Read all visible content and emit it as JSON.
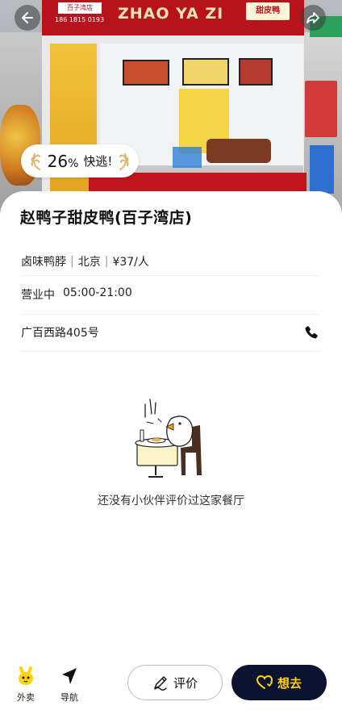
{
  "hero": {
    "branch_tag": "百子湾店",
    "phone": "186 1815 0193",
    "brand": "ZHAO YA ZI",
    "sign_right": "甜皮鸭"
  },
  "badge": {
    "percent": "26",
    "percent_sign": "%",
    "label": "快逃!"
  },
  "shop": {
    "name": "赵鸭子甜皮鸭(百子湾店)",
    "category": "卤味鸭脖",
    "city": "北京",
    "price": "¥37/人",
    "separator": "|",
    "status": "营业中",
    "hours": "05:00-21:00",
    "address": "广百西路405号"
  },
  "empty_state": {
    "message": "还没有小伙伴评价过这家餐厅"
  },
  "bottom_bar": {
    "takeout_label": "外卖",
    "navigate_label": "导航",
    "review_label": "评价",
    "want_label": "想去"
  },
  "colors": {
    "primary_dark": "#0c1330",
    "accent_yellow": "#ffd400",
    "sign_red": "#b8121b"
  },
  "icons": [
    "back-arrow-icon",
    "share-icon",
    "wheat-left-icon",
    "wheat-right-icon",
    "phone-icon",
    "takeout-mascot-icon",
    "navigation-arrow-icon",
    "pen-icon",
    "heart-icon"
  ]
}
